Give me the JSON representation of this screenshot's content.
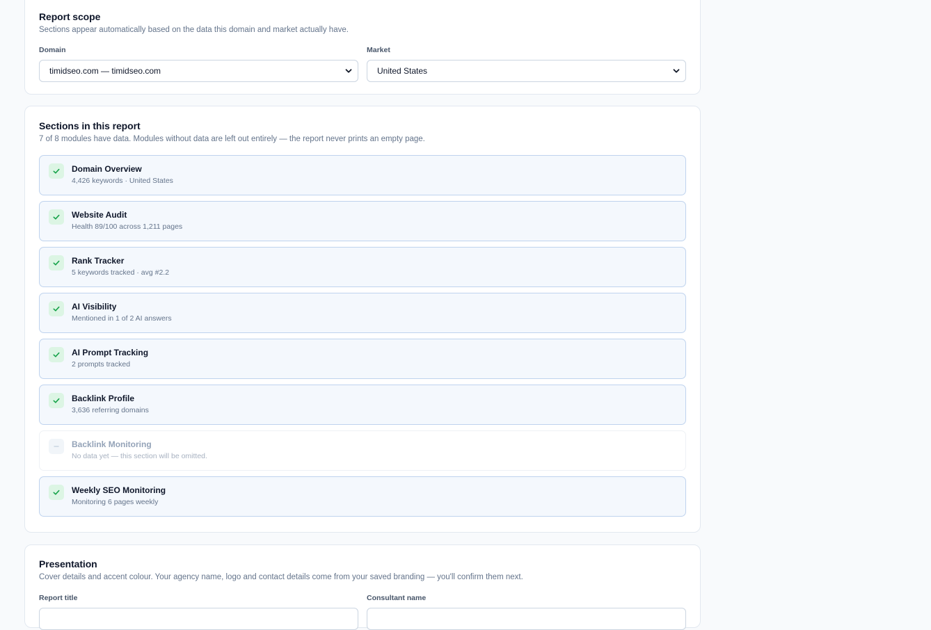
{
  "scope": {
    "title": "Report scope",
    "description": "Sections appear automatically based on the data this domain and market actually have.",
    "domain_label": "Domain",
    "domain_value": "timidseo.com — timidseo.com",
    "market_label": "Market",
    "market_value": "United States"
  },
  "sections": {
    "title": "Sections in this report",
    "description": "7 of 8 modules have data. Modules without data are left out entirely — the report never prints an empty page.",
    "modules": [
      {
        "name": "Domain Overview",
        "detail": "4,426 keywords · United States",
        "has_data": true
      },
      {
        "name": "Website Audit",
        "detail": "Health 89/100 across 1,211 pages",
        "has_data": true
      },
      {
        "name": "Rank Tracker",
        "detail": "5 keywords tracked · avg #2.2",
        "has_data": true
      },
      {
        "name": "AI Visibility",
        "detail": "Mentioned in 1 of 2 AI answers",
        "has_data": true
      },
      {
        "name": "AI Prompt Tracking",
        "detail": "2 prompts tracked",
        "has_data": true
      },
      {
        "name": "Backlink Profile",
        "detail": "3,636 referring domains",
        "has_data": true
      },
      {
        "name": "Backlink Monitoring",
        "detail": "No data yet — this section will be omitted.",
        "has_data": false
      },
      {
        "name": "Weekly SEO Monitoring",
        "detail": "Monitoring 6 pages weekly",
        "has_data": true
      }
    ]
  },
  "presentation": {
    "title": "Presentation",
    "description": "Cover details and accent colour. Your agency name, logo and contact details come from your saved branding — you'll confirm them next.",
    "report_title_label": "Report title",
    "consultant_label": "Consultant name"
  },
  "colors": {
    "check_green": "#16a34a",
    "module_border": "#bfd3ee",
    "module_bg": "#f4f8fd"
  },
  "icons": {
    "included": "check-icon",
    "omitted": "dash-icon",
    "select": "chevron-down-icon"
  }
}
